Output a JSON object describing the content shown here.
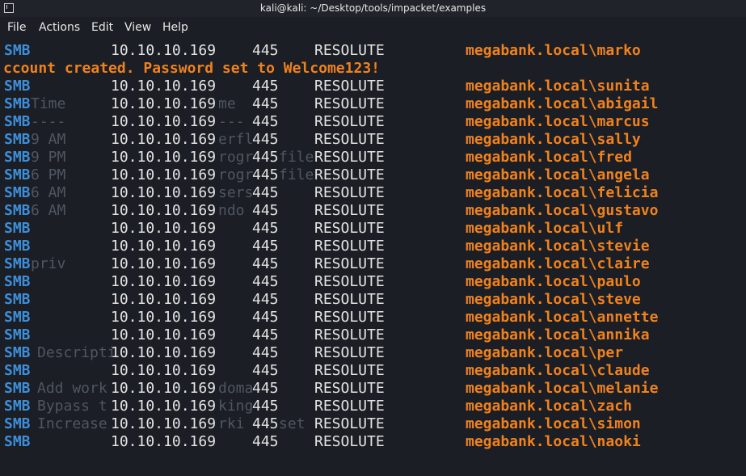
{
  "window": {
    "title": "kali@kali: ~/Desktop/tools/impacket/examples"
  },
  "menu": [
    "File",
    "Actions",
    "Edit",
    "View",
    "Help"
  ],
  "colors": {
    "protocol": "#3d8fdb",
    "account": "#f0821e",
    "text": "#e4e4e4",
    "background": "#1b1e24"
  },
  "terminal": {
    "message": "ccount created. Password set to Welcome123!",
    "columns": {
      "protocol": "SMB",
      "ip": "10.10.10.169",
      "port": "445",
      "host": "RESOLUTE"
    },
    "accounts_before": [
      "megabank.local\\marko"
    ],
    "accounts_after": [
      "megabank.local\\sunita",
      "megabank.local\\abigail",
      "megabank.local\\marcus",
      "megabank.local\\sally",
      "megabank.local\\fred",
      "megabank.local\\angela",
      "megabank.local\\felicia",
      "megabank.local\\gustavo",
      "megabank.local\\ulf",
      "megabank.local\\stevie",
      "megabank.local\\claire",
      "megabank.local\\paulo",
      "megabank.local\\steve",
      "megabank.local\\annette",
      "megabank.local\\annika",
      "megabank.local\\per",
      "megabank.local\\claude",
      "megabank.local\\melanie",
      "megabank.local\\zach",
      "megabank.local\\simon",
      "megabank.local\\naoki"
    ]
  },
  "background_ghost_text": [
    "Time",
    "----",
    "9 AM",
    "9 PM",
    "6 PM",
    "6 AM",
    "6 AM",
    "priv",
    "Descripti",
    "Add work",
    "Bypass t",
    "Increase",
    "me",
    "---",
    "erfl",
    "rogr",
    "rogr",
    "sers",
    "ndo",
    "file",
    "file",
    "doma",
    "king",
    "rki",
    "set"
  ]
}
